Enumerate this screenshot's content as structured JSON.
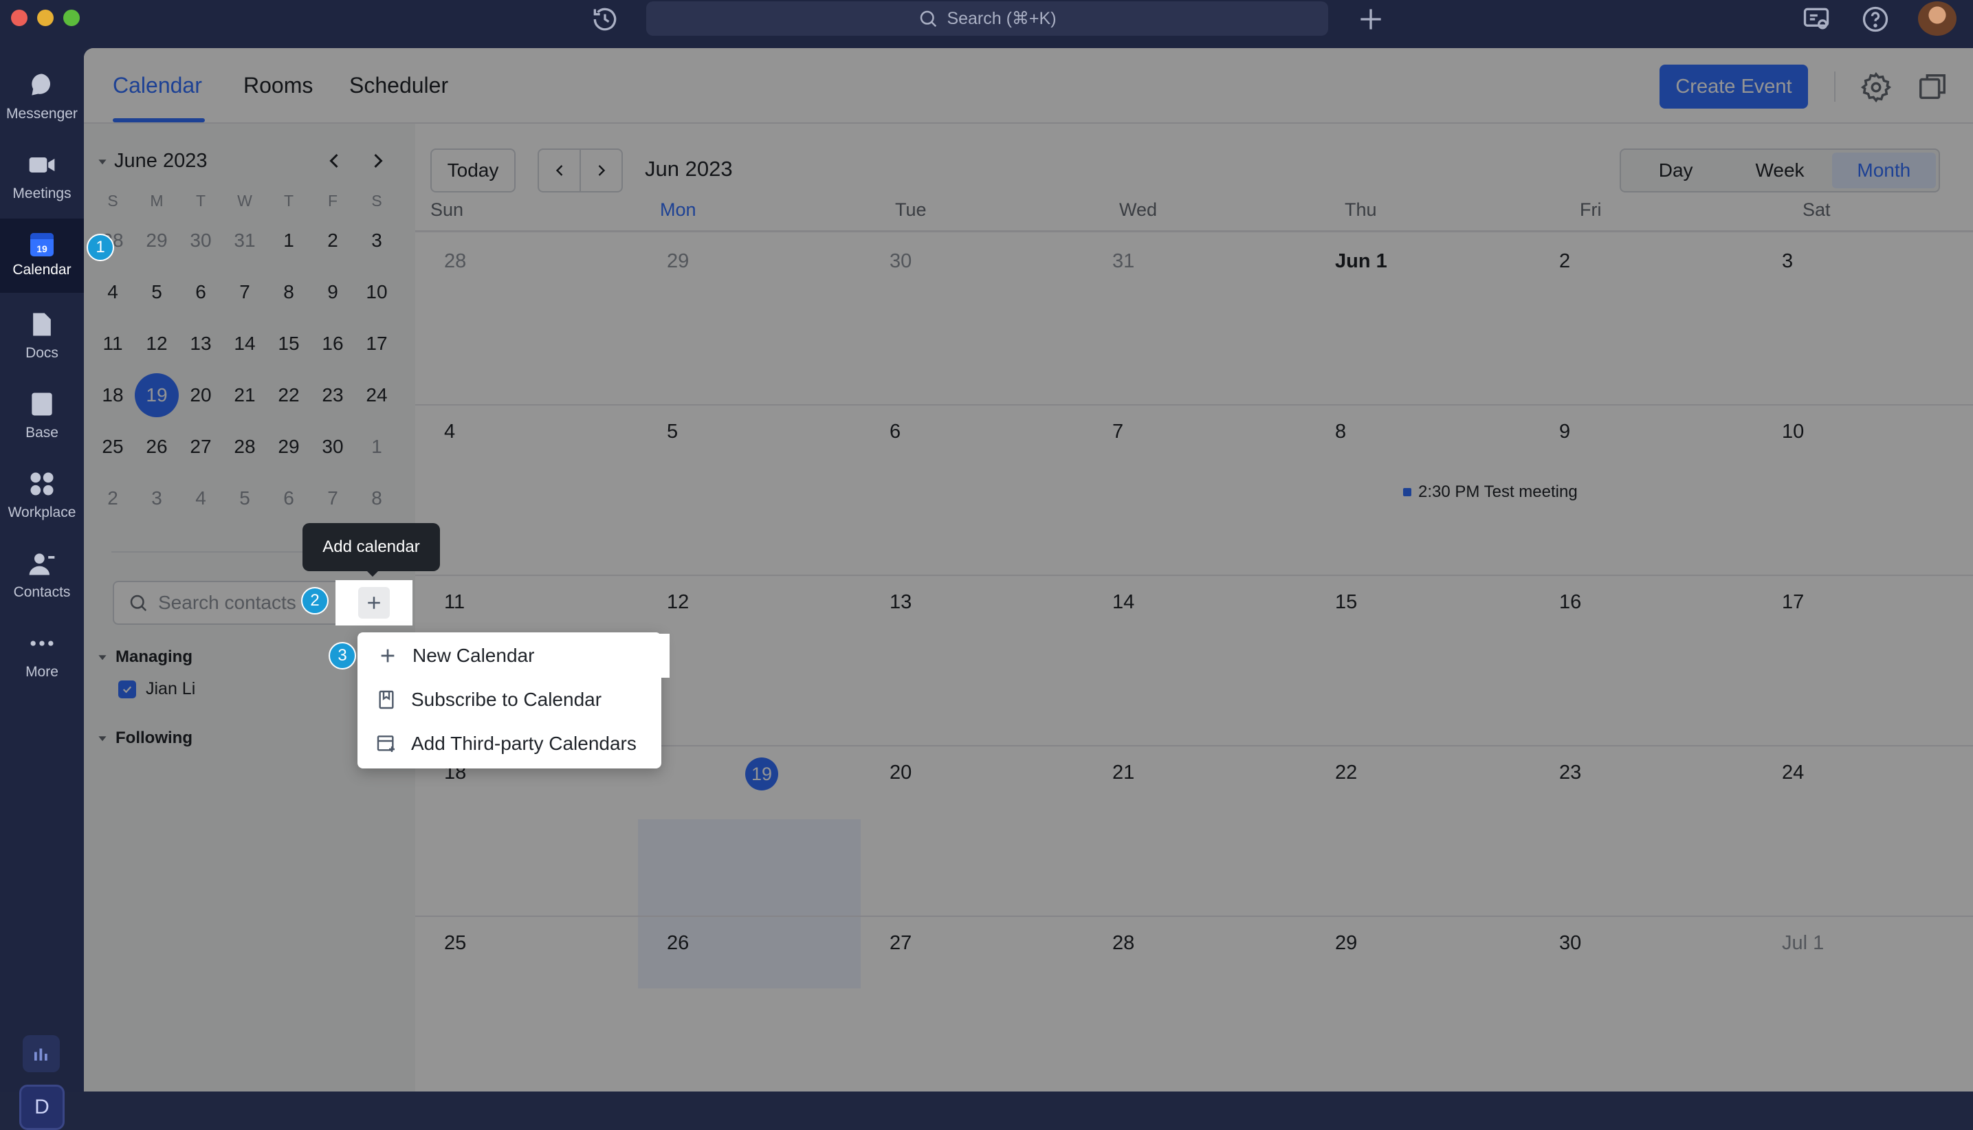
{
  "titlebar": {
    "search_placeholder": "Search (⌘+K)",
    "icons": [
      "history-icon",
      "search-icon",
      "plus-icon",
      "feedback-icon",
      "help-icon",
      "avatar"
    ]
  },
  "rail": {
    "items": [
      {
        "label": "Messenger",
        "icon": "messenger-icon"
      },
      {
        "label": "Meetings",
        "icon": "video-icon"
      },
      {
        "label": "Calendar",
        "icon": "calendar-icon",
        "active": true,
        "icon_text": "19"
      },
      {
        "label": "Docs",
        "icon": "docs-icon"
      },
      {
        "label": "Base",
        "icon": "base-icon"
      },
      {
        "label": "Workplace",
        "icon": "workplace-icon"
      },
      {
        "label": "Contacts",
        "icon": "contacts-icon"
      },
      {
        "label": "More",
        "icon": "more-icon"
      }
    ],
    "user_initial": "D"
  },
  "tabs": {
    "items": [
      "Calendar",
      "Rooms",
      "Scheduler"
    ],
    "active": "Calendar"
  },
  "header": {
    "create_event": "Create Event"
  },
  "mini_calendar": {
    "title": "June 2023",
    "dow": [
      "S",
      "M",
      "T",
      "W",
      "T",
      "F",
      "S"
    ],
    "weeks": [
      [
        "28",
        "29",
        "30",
        "31",
        "1",
        "2",
        "3"
      ],
      [
        "4",
        "5",
        "6",
        "7",
        "8",
        "9",
        "10"
      ],
      [
        "11",
        "12",
        "13",
        "14",
        "15",
        "16",
        "17"
      ],
      [
        "18",
        "19",
        "20",
        "21",
        "22",
        "23",
        "24"
      ],
      [
        "25",
        "26",
        "27",
        "28",
        "29",
        "30",
        "1"
      ],
      [
        "2",
        "3",
        "4",
        "5",
        "6",
        "7",
        "8"
      ]
    ],
    "today": "19"
  },
  "sidebar": {
    "search_placeholder": "Search contacts",
    "add_calendar_tooltip": "Add calendar",
    "managing_label": "Managing",
    "managing_items": [
      {
        "name": "Jian Li",
        "checked": true
      }
    ],
    "following_label": "Following"
  },
  "dropdown": {
    "items": [
      "New Calendar",
      "Subscribe to Calendar",
      "Add Third-party Calendars"
    ]
  },
  "toolbar": {
    "today": "Today",
    "month_title": "Jun 2023",
    "views": [
      "Day",
      "Week",
      "Month"
    ],
    "selected_view": "Month"
  },
  "month_grid": {
    "dow": [
      "Sun",
      "Mon",
      "Tue",
      "Wed",
      "Thu",
      "Fri",
      "Sat"
    ],
    "weeks": [
      [
        "28",
        "29",
        "30",
        "31",
        "Jun 1",
        "2",
        "3"
      ],
      [
        "4",
        "5",
        "6",
        "7",
        "8",
        "9",
        "10"
      ],
      [
        "11",
        "12",
        "13",
        "14",
        "15",
        "16",
        "17"
      ],
      [
        "18",
        "19",
        "20",
        "21",
        "22",
        "23",
        "24"
      ],
      [
        "25",
        "26",
        "27",
        "28",
        "29",
        "30",
        "Jul 1"
      ]
    ],
    "today": "19",
    "event": "2:30 PM Test meeting"
  },
  "callouts": [
    "1",
    "2",
    "3"
  ],
  "colors": {
    "accent": "#3370ff",
    "rail_bg": "#1e2540",
    "badge": "#1a9bd7"
  }
}
